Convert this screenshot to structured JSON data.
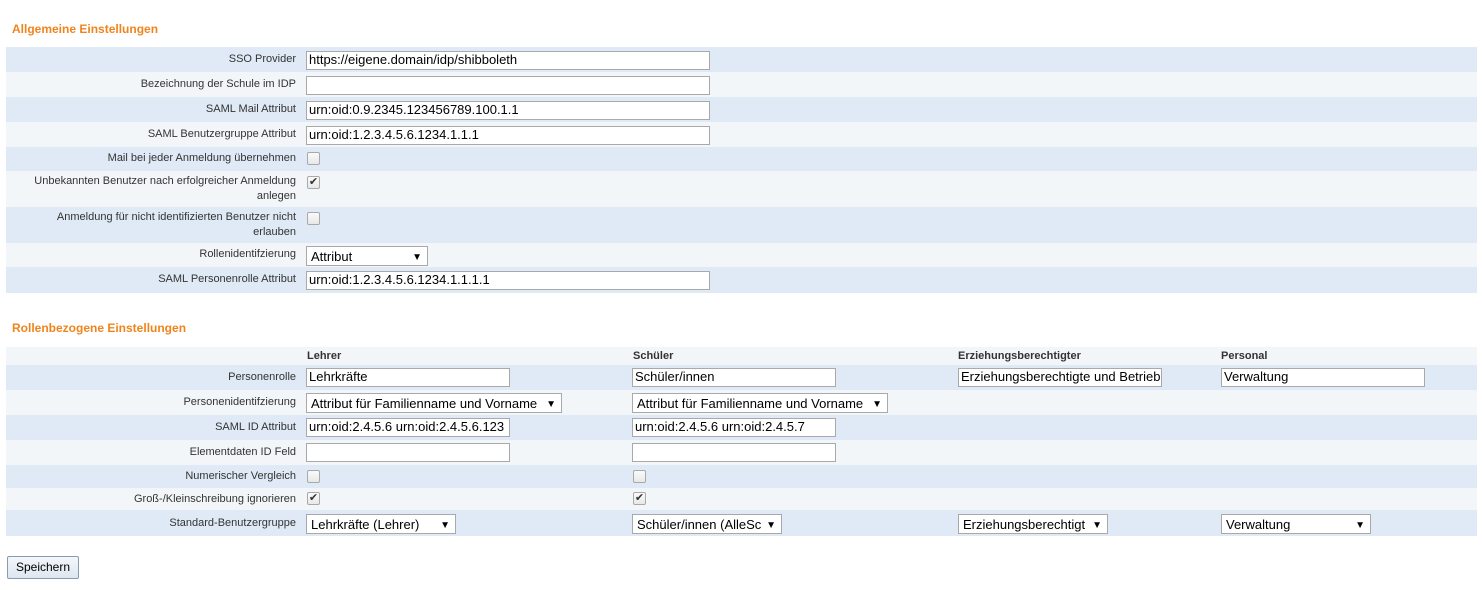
{
  "general": {
    "title": "Allgemeine Einstellungen",
    "sso_provider": {
      "label": "SSO Provider",
      "value": "https://eigene.domain/idp/shibboleth"
    },
    "school_name": {
      "label": "Bezeichnung der Schule im IDP",
      "value": ""
    },
    "mail_attr": {
      "label": "SAML Mail Attribut",
      "value": "urn:oid:0.9.2345.123456789.100.1.1"
    },
    "group_attr": {
      "label": "SAML Benutzergruppe Attribut",
      "value": "urn:oid:1.2.3.4.5.6.1234.1.1.1"
    },
    "mail_each_login": {
      "label": "Mail bei jeder Anmeldung übernehmen",
      "checked": false
    },
    "create_unknown": {
      "label_1": "Unbekannten Benutzer nach erfolgreicher Anmeldung",
      "label_2": "anlegen",
      "checked": true
    },
    "deny_unidentified": {
      "label_1": "Anmeldung für nicht identifizierten Benutzer nicht",
      "label_2": "erlauben",
      "checked": false
    },
    "role_ident": {
      "label": "Rollenidentifzierung",
      "value": "Attribut"
    },
    "person_role_attr": {
      "label": "SAML Personenrolle Attribut",
      "value": "urn:oid:1.2.3.4.5.6.1234.1.1.1.1"
    }
  },
  "roles": {
    "title": "Rollenbezogene Einstellungen",
    "columns": [
      "Lehrer",
      "Schüler",
      "Erziehungsberechtigter",
      "Personal"
    ],
    "rows": {
      "person_role": "Personenrolle",
      "person_ident": "Personenidentifzierung",
      "saml_id": "SAML ID Attribut",
      "element_id": "Elementdaten ID Feld",
      "numeric": "Numerischer Vergleich",
      "ignore_case": "Groß-/Kleinschreibung ignorieren",
      "default_group": "Standard-Benutzergruppe"
    },
    "lehrer": {
      "person_role": "Lehrkräfte",
      "person_ident": "Attribut für Familienname und Vorname",
      "saml_id": "urn:oid:2.4.5.6 urn:oid:2.4.5.6.123",
      "element_id": "",
      "numeric": false,
      "ignore_case": true,
      "default_group": "Lehrkräfte (Lehrer)"
    },
    "schueler": {
      "person_role": "Schüler/innen",
      "person_ident": "Attribut für Familienname und Vorname",
      "saml_id": "urn:oid:2.4.5.6 urn:oid:2.4.5.7",
      "element_id": "",
      "numeric": false,
      "ignore_case": true,
      "default_group": "Schüler/innen (AlleSc"
    },
    "erzb": {
      "person_role": "Erziehungsberechtigte und Betrieb",
      "default_group": "Erziehungsberechtigt"
    },
    "personal": {
      "person_role": "Verwaltung",
      "default_group": "Verwaltung"
    }
  },
  "save_label": "Speichern",
  "icons": {
    "dropdown": "▼",
    "check": "✔"
  }
}
